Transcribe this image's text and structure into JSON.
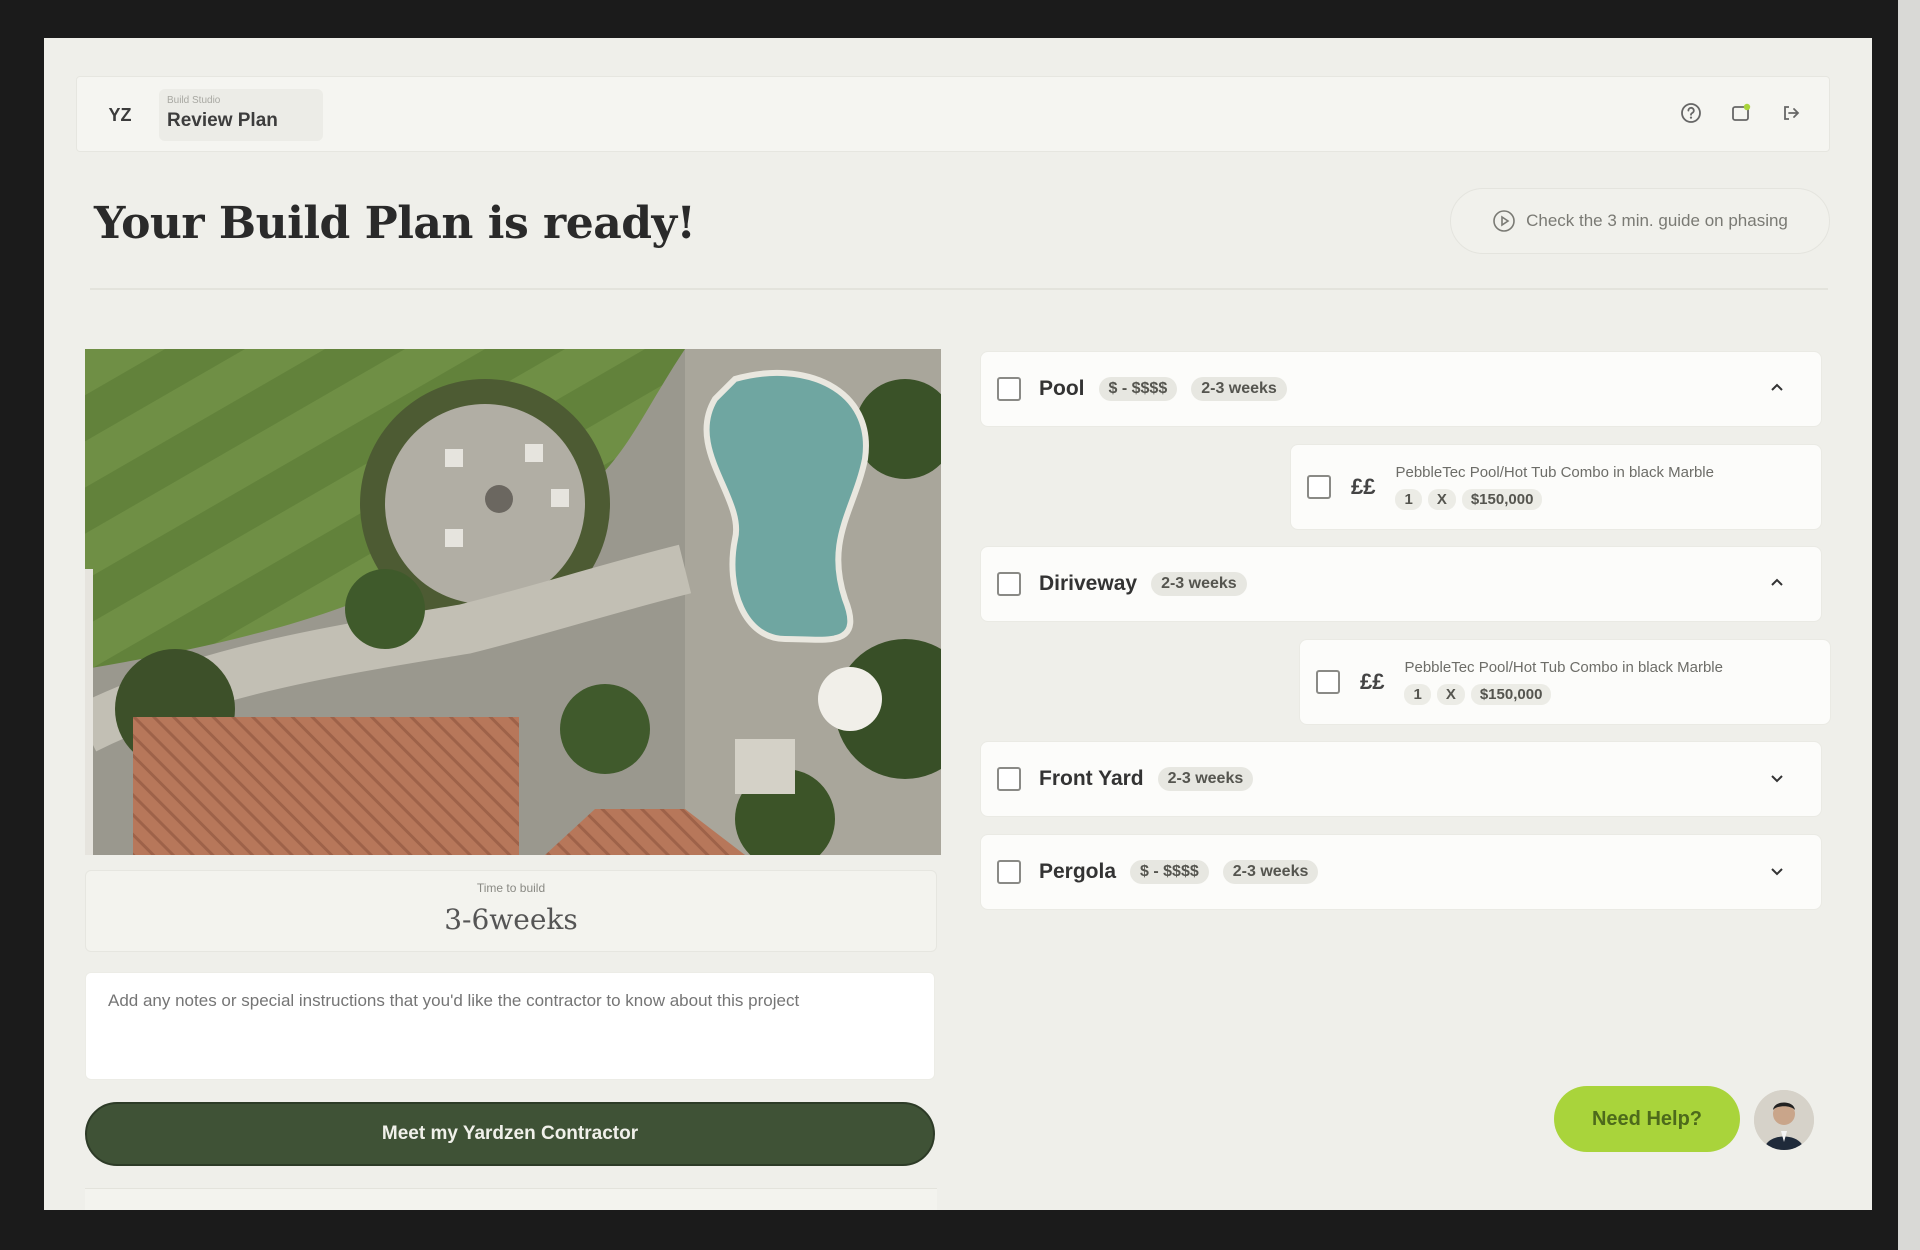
{
  "header": {
    "logo": "YZ",
    "crumb_small": "Build Studio",
    "crumb_title": "Review Plan",
    "icons": [
      "help-icon",
      "notification-icon",
      "logout-icon"
    ]
  },
  "title": "Your Build Plan is ready!",
  "guide": {
    "label": "Check the 3 min. guide on phasing",
    "icon": "play-icon"
  },
  "left": {
    "time_label": "Time to build",
    "time_value": "3-6weeks",
    "notes_placeholder": "Add any notes or special instructions that you'd like the contractor to know about this project",
    "cta_label": "Meet my Yardzen Contractor"
  },
  "categories": [
    {
      "name": "Pool",
      "price": "$ - $$$$",
      "duration": "2-3 weeks",
      "expanded": true
    },
    {
      "name": "Diriveway",
      "duration": "2-3 weeks",
      "expanded": true
    },
    {
      "name": "Front Yard",
      "duration": "2-3 weeks",
      "expanded": false
    },
    {
      "name": "Pergola",
      "price": "$ - $$$$",
      "duration": "2-3 weeks",
      "expanded": false
    }
  ],
  "items": [
    {
      "icon": "££",
      "title": "PebbleTec Pool/Hot Tub Combo in black Marble",
      "qty": "1",
      "x": "X",
      "price": "$150,000"
    },
    {
      "icon": "££",
      "title": "PebbleTec Pool/Hot Tub Combo in black Marble",
      "qty": "1",
      "x": "X",
      "price": "$150,000"
    }
  ],
  "help_label": "Need Help?",
  "colors": {
    "accent": "#3f5236",
    "help": "#a9d43b",
    "background": "#efefea"
  }
}
